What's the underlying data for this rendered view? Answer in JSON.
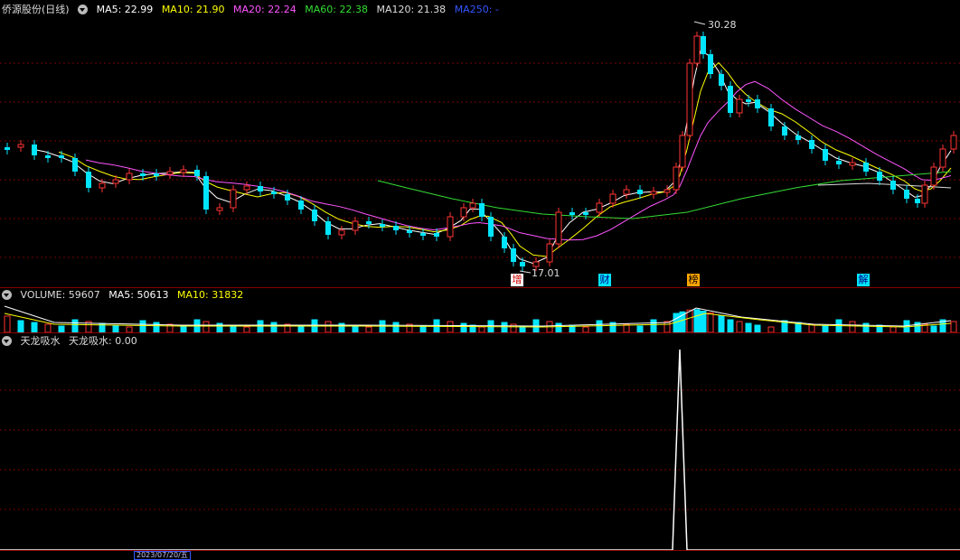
{
  "price_pane": {
    "title": "侨源股份(日线)",
    "ma": [
      {
        "label": "MA5: 22.99",
        "color": "#ffffff"
      },
      {
        "label": "MA10: 21.90",
        "color": "#ffff00"
      },
      {
        "label": "MA20: 22.24",
        "color": "#ff55ff"
      },
      {
        "label": "MA60: 22.38",
        "color": "#33dd33"
      },
      {
        "label": "MA120: 21.38",
        "color": "#dddddd"
      },
      {
        "label": "MA250: -",
        "color": "#3355ff"
      }
    ],
    "high_label": "30.28",
    "low_label": "17.01",
    "events": [
      {
        "text": "增",
        "bg": "#ffffff",
        "color": "#cc0000"
      },
      {
        "text": "财",
        "bg": "#00e5ff",
        "color": "#000080"
      },
      {
        "text": "榜",
        "bg": "#ffa500",
        "color": "#000000"
      },
      {
        "text": "解",
        "bg": "#00e5ff",
        "color": "#000080"
      }
    ]
  },
  "volume_pane": {
    "title": "VOLUME: 59607",
    "ma5": "MA5: 50613",
    "ma10": "MA10: 31832"
  },
  "indicator_pane": {
    "title": "天龙吸水",
    "value_label": "天龙吸水: 0.00"
  },
  "axis": {
    "date_highlight": "2023/07/20/五"
  },
  "colors": {
    "up": "#ff3333",
    "down": "#00e5ff",
    "grid": "#7a0000",
    "separator": "#8b0000"
  }
}
